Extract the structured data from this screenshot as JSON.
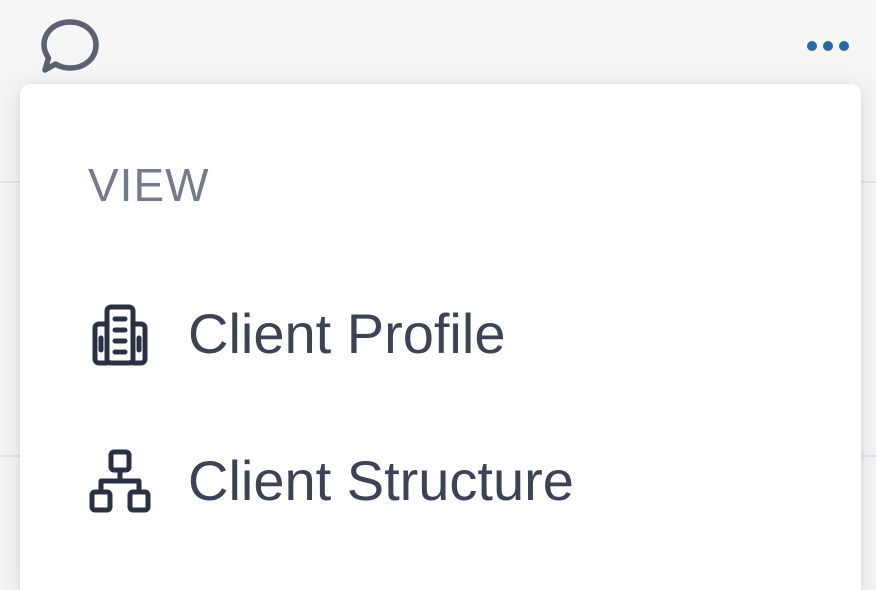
{
  "toolbar": {
    "comment_icon": "speech-bubble-icon",
    "more_icon": "more-horizontal-icon",
    "accent_color": "#2b69a6"
  },
  "menu": {
    "section_header": "VIEW",
    "items": [
      {
        "label": "Client Profile",
        "icon": "building-icon"
      },
      {
        "label": "Client Structure",
        "icon": "org-chart-icon"
      }
    ]
  },
  "colors": {
    "header_text": "#737b8c",
    "item_text": "#3b4354",
    "icon_color": "#2a3142"
  }
}
